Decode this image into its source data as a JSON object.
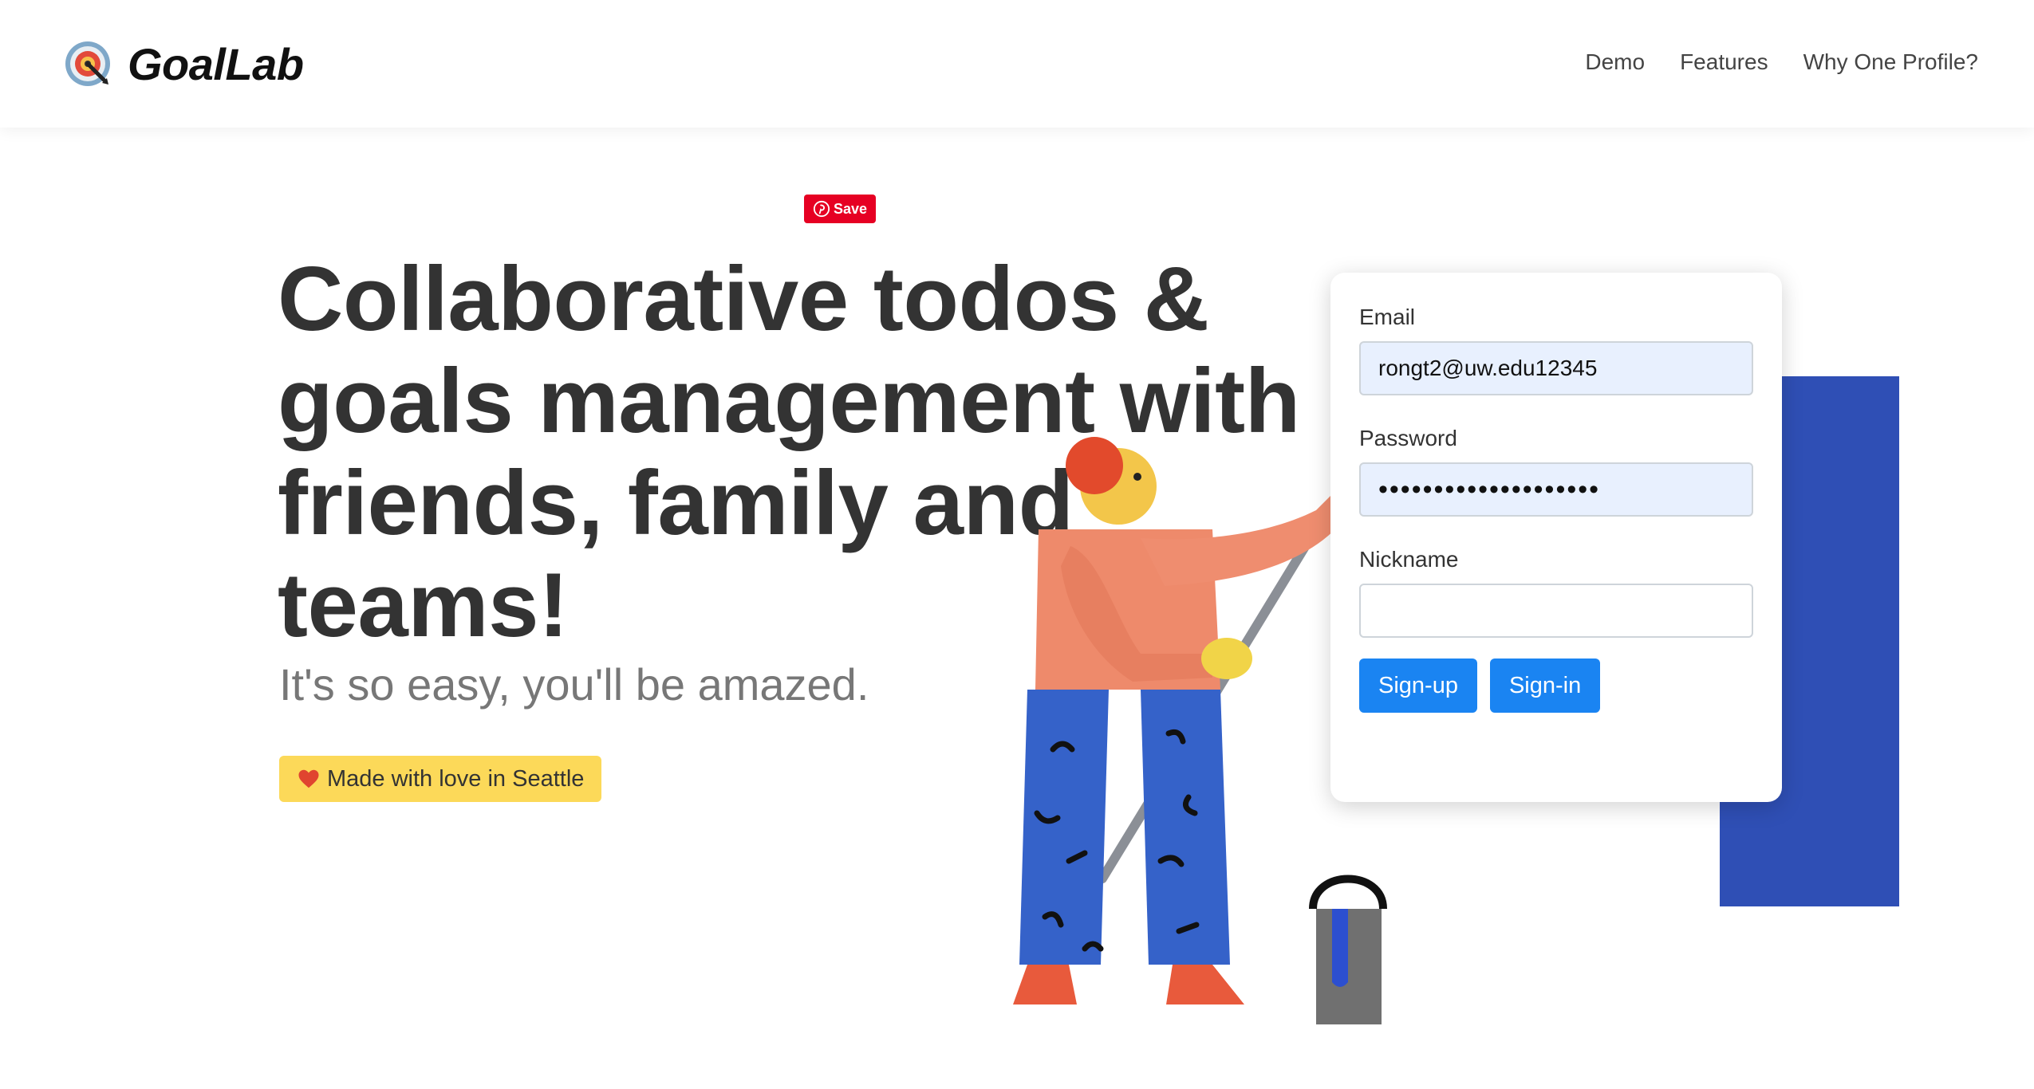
{
  "header": {
    "brand_name": "GoalLab",
    "nav": [
      {
        "label": "Demo"
      },
      {
        "label": "Features"
      },
      {
        "label": "Why One Profile?"
      }
    ]
  },
  "pin_save_label": "Save",
  "hero": {
    "title": "Collaborative todos & goals management with friends, family and teams!",
    "subtitle": "It's so easy, you'll be amazed.",
    "badge": "Made with love in Seattle"
  },
  "form": {
    "email_label": "Email",
    "email_value": "rongt2@uw.edu12345",
    "password_label": "Password",
    "password_value": "••••••••••••••••••••",
    "nickname_label": "Nickname",
    "nickname_value": "",
    "signup_label": "Sign-up",
    "signin_label": "Sign-in"
  },
  "colors": {
    "accent": "#1a84f2",
    "badge": "#fcd959",
    "pinterest": "#e60023",
    "panel_blue": "#2f4fb5"
  }
}
